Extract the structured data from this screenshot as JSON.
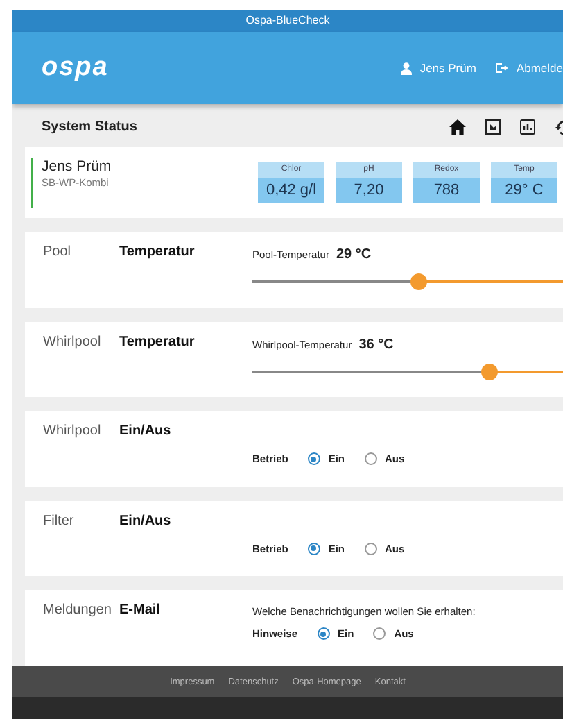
{
  "window": {
    "title": "Ospa-BlueCheck"
  },
  "header": {
    "logo": "ospa",
    "user": "Jens Prüm",
    "logout": "Abmelde"
  },
  "toolbar": {
    "title": "System Status"
  },
  "status": {
    "name": "Jens Prüm",
    "subtitle": "SB-WP-Kombi",
    "metrics": [
      {
        "label": "Chlor",
        "value": "0,42 g/l"
      },
      {
        "label": "pH",
        "value": "7,20"
      },
      {
        "label": "Redox",
        "value": "788"
      },
      {
        "label": "Temp",
        "value": "29° C"
      }
    ]
  },
  "sections": [
    {
      "kind": "slider",
      "category": "Pool",
      "title": "Temperatur",
      "label": "Pool-Temperatur",
      "reading": "29 °C",
      "level": 0.4
    },
    {
      "kind": "slider",
      "category": "Whirlpool",
      "title": "Temperatur",
      "label": "Whirlpool-Temperatur",
      "reading": "36 °C",
      "level": 0.57
    },
    {
      "kind": "radio",
      "category": "Whirlpool",
      "title": "Ein/Aus",
      "label": "Betrieb",
      "options": [
        {
          "label": "Ein",
          "selected": true
        },
        {
          "label": "Aus",
          "selected": false
        }
      ]
    },
    {
      "kind": "radio",
      "category": "Filter",
      "title": "Ein/Aus",
      "label": "Betrieb",
      "options": [
        {
          "label": "Ein",
          "selected": true
        },
        {
          "label": "Aus",
          "selected": false
        }
      ]
    },
    {
      "kind": "radio",
      "category": "Meldungen",
      "title": "E-Mail",
      "description": "Welche Benachrichtigungen wollen Sie erhalten:",
      "label": "Hinweise",
      "options": [
        {
          "label": "Ein",
          "selected": true
        },
        {
          "label": "Aus",
          "selected": false
        }
      ]
    }
  ],
  "footer": {
    "links": [
      "Impressum",
      "Datenschutz",
      "Ospa-Homepage",
      "Kontakt"
    ]
  }
}
